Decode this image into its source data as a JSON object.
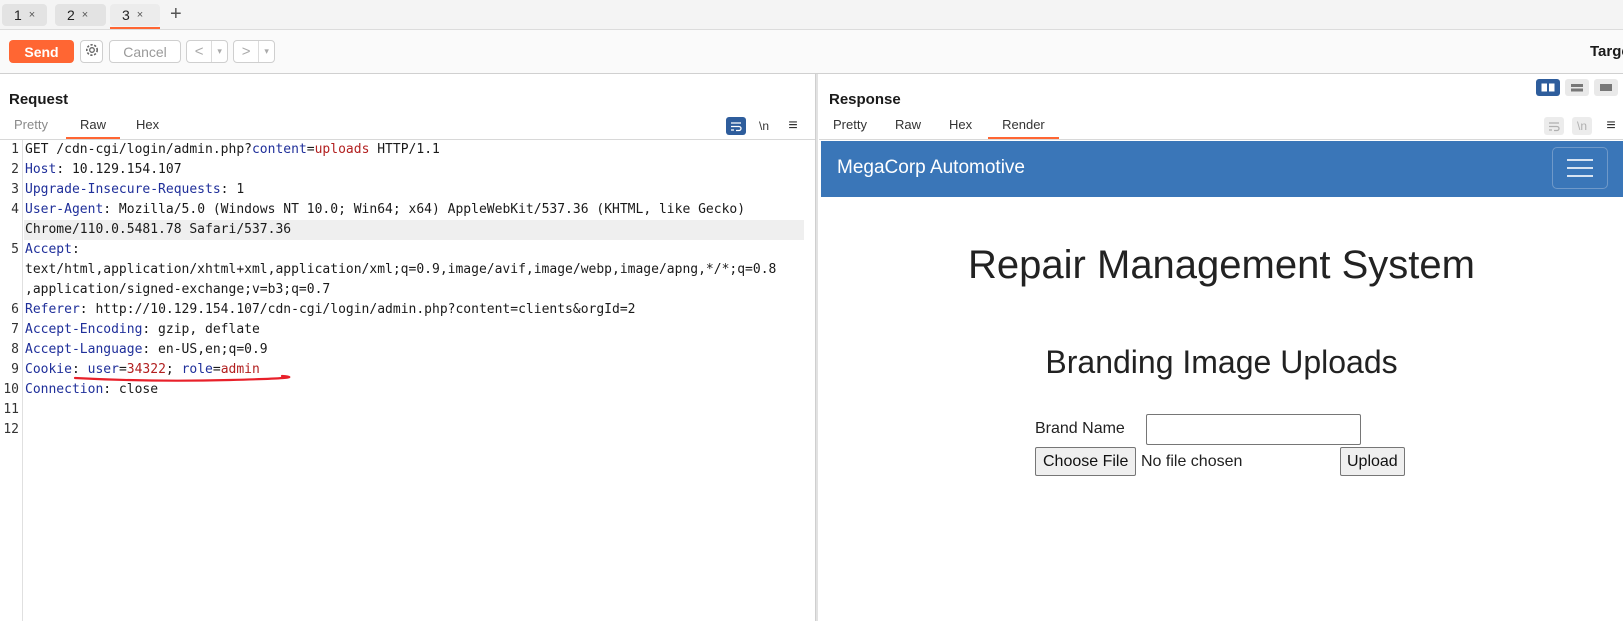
{
  "tabs": [
    {
      "label": "1",
      "close": "×"
    },
    {
      "label": "2",
      "close": "×"
    },
    {
      "label": "3",
      "close": "×"
    }
  ],
  "tab_add": "+",
  "toolbar": {
    "send_label": "Send",
    "cancel_label": "Cancel",
    "back_label": "<",
    "forward_label": ">",
    "dropdown_caret": "▾",
    "target_label": "Target"
  },
  "request": {
    "title": "Request",
    "tabs": [
      "Pretty",
      "Raw",
      "Hex"
    ],
    "active_tab": "Raw",
    "newline_toggle": "\\n",
    "menu_icon": "≡",
    "line_numbers": [
      "1",
      "2",
      "3",
      "4",
      "5",
      "6",
      "7",
      "8",
      "9",
      "10",
      "11",
      "12"
    ],
    "lines": {
      "l1_method": "GET /cdn-cgi/login/admin.php?",
      "l1_param": "content",
      "l1_eq": "=",
      "l1_value": "uploads",
      "l1_proto": " HTTP/1.1",
      "l2_key": "Host",
      "l2_val": ": 10.129.154.107",
      "l3_key": "Upgrade-Insecure-Requests",
      "l3_val": ": 1",
      "l4_key": "User-Agent",
      "l4_val": ": Mozilla/5.0 (Windows NT 10.0; Win64; x64) AppleWebKit/537.36 (KHTML, like Gecko)",
      "l4_wrap": "Chrome/110.0.5481.78 Safari/537.36",
      "l5_key": "Accept",
      "l5_val": ":",
      "l5_wrap1": "text/html,application/xhtml+xml,application/xml;q=0.9,image/avif,image/webp,image/apng,*/*;q=0.8",
      "l5_wrap2": ",application/signed-exchange;v=b3;q=0.7",
      "l6_key": "Referer",
      "l6_val": ": http://10.129.154.107/cdn-cgi/login/admin.php?content=clients&orgId=2",
      "l7_key": "Accept-Encoding",
      "l7_val": ": gzip, deflate",
      "l8_key": "Accept-Language",
      "l8_val": ": en-US,en;q=0.9",
      "l9_key": "Cookie",
      "l9_colon": ": ",
      "l9_c1_key": "user",
      "l9_c1_eq": "=",
      "l9_c1_val": "34322",
      "l9_sep": "; ",
      "l9_c2_key": "role",
      "l9_c2_eq": "=",
      "l9_c2_val": "admin",
      "l10_key": "Connection",
      "l10_val": ": close"
    }
  },
  "response": {
    "title": "Response",
    "tabs": [
      "Pretty",
      "Raw",
      "Hex",
      "Render"
    ],
    "active_tab": "Render",
    "newline_toggle": "\\n",
    "menu_icon": "≡",
    "render": {
      "brand": "MegaCorp Automotive",
      "heading": "Repair Management System",
      "subheading": "Branding Image Uploads",
      "brand_name_label": "Brand Name",
      "brand_name_value": "",
      "choose_file_label": "Choose File",
      "no_file_text": "No file chosen",
      "upload_label": "Upload"
    }
  },
  "colors": {
    "accent": "#ff6633",
    "header_key": "#1f2f9a",
    "header_value": "#b21f1f",
    "navbar": "#3a76b8",
    "annotation": "#e8202a"
  },
  "icons": [
    "gear-icon",
    "word-wrap-icon",
    "menu-icon",
    "layout-split-icon",
    "layout-rows-icon",
    "layout-single-icon",
    "hamburger-icon"
  ]
}
